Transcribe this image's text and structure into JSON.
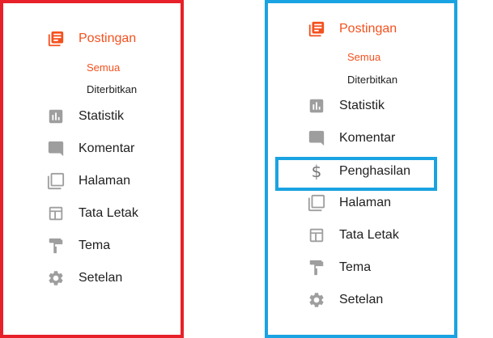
{
  "colors": {
    "accent": "#f4511e",
    "icon_gray": "#9e9e9e",
    "left_frame": "#e8202a",
    "right_frame": "#1aa3e2"
  },
  "left_menu": {
    "items": [
      {
        "label": "Postingan",
        "icon": "posts-icon",
        "active": true
      },
      {
        "label": "Statistik",
        "icon": "stats-icon"
      },
      {
        "label": "Komentar",
        "icon": "comment-icon"
      },
      {
        "label": "Halaman",
        "icon": "pages-icon"
      },
      {
        "label": "Tata Letak",
        "icon": "layout-icon"
      },
      {
        "label": "Tema",
        "icon": "theme-icon"
      },
      {
        "label": "Setelan",
        "icon": "settings-icon"
      }
    ],
    "subitems": [
      {
        "label": "Semua",
        "selected": true
      },
      {
        "label": "Diterbitkan"
      }
    ]
  },
  "right_menu": {
    "items": [
      {
        "label": "Postingan",
        "icon": "posts-icon",
        "active": true
      },
      {
        "label": "Statistik",
        "icon": "stats-icon"
      },
      {
        "label": "Komentar",
        "icon": "comment-icon"
      },
      {
        "label": "Penghasilan",
        "icon": "dollar-icon",
        "highlighted": true
      },
      {
        "label": "Halaman",
        "icon": "pages-icon"
      },
      {
        "label": "Tata Letak",
        "icon": "layout-icon"
      },
      {
        "label": "Tema",
        "icon": "theme-icon"
      },
      {
        "label": "Setelan",
        "icon": "settings-icon"
      }
    ],
    "subitems": [
      {
        "label": "Semua",
        "selected": true
      },
      {
        "label": "Diterbitkan"
      }
    ]
  }
}
